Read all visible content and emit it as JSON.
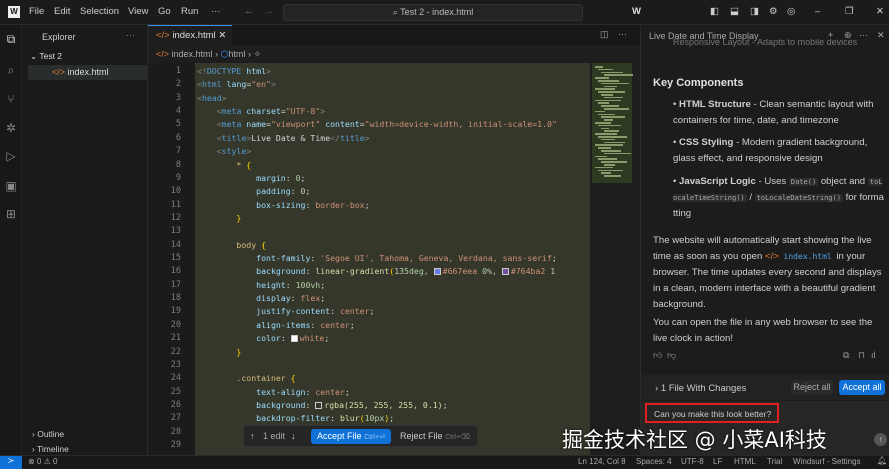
{
  "menu": [
    "File",
    "Edit",
    "Selection",
    "View",
    "Go",
    "Run",
    "···"
  ],
  "search": "⌕ Test 2 - index.html",
  "explorer": {
    "title": "Explorer",
    "folder": "Test 2",
    "file": "index.html",
    "outline": "Outline",
    "timeline": "Timeline"
  },
  "editor": {
    "tab": "index.html",
    "crumb_file": "index.html",
    "crumb_html": "html",
    "lines": [
      [
        [
          "<!",
          "br"
        ],
        [
          "DOCTYPE",
          "tag"
        ],
        [
          " html",
          "attr"
        ],
        [
          ">",
          "br"
        ]
      ],
      [
        [
          "<",
          "br"
        ],
        [
          "html",
          "tag"
        ],
        [
          " lang",
          "attr"
        ],
        [
          "=",
          "txt"
        ],
        [
          "\"en\"",
          "str"
        ],
        [
          ">",
          "br"
        ]
      ],
      [
        [
          "<",
          "br"
        ],
        [
          "head",
          "tag"
        ],
        [
          ">",
          "br"
        ]
      ],
      [
        [
          "    <",
          "br"
        ],
        [
          "meta",
          "tag"
        ],
        [
          " charset",
          "attr"
        ],
        [
          "=",
          "txt"
        ],
        [
          "\"UTF-8\"",
          "str"
        ],
        [
          ">",
          "br"
        ]
      ],
      [
        [
          "    <",
          "br"
        ],
        [
          "meta",
          "tag"
        ],
        [
          " name",
          "attr"
        ],
        [
          "=",
          "txt"
        ],
        [
          "\"viewport\"",
          "str"
        ],
        [
          " content",
          "attr"
        ],
        [
          "=",
          "txt"
        ],
        [
          "\"width=device-width, initial-scale=1.0\"",
          "str"
        ]
      ],
      [
        [
          "    <",
          "br"
        ],
        [
          "title",
          "tag"
        ],
        [
          ">",
          "br"
        ],
        [
          "Live Date & Time",
          "txt"
        ],
        [
          "</",
          "br"
        ],
        [
          "title",
          "tag"
        ],
        [
          ">",
          "br"
        ]
      ],
      [
        [
          "    <",
          "br"
        ],
        [
          "style",
          "tag"
        ],
        [
          ">",
          "br"
        ]
      ],
      [
        [
          "        * ",
          "sel"
        ],
        [
          "{",
          "bra"
        ]
      ],
      [
        [
          "            margin",
          "prop"
        ],
        [
          ": ",
          "txt"
        ],
        [
          "0",
          "num"
        ],
        [
          ";",
          "txt"
        ]
      ],
      [
        [
          "            padding",
          "prop"
        ],
        [
          ": ",
          "txt"
        ],
        [
          "0",
          "num"
        ],
        [
          ";",
          "txt"
        ]
      ],
      [
        [
          "            box-sizing",
          "prop"
        ],
        [
          ": ",
          "txt"
        ],
        [
          "border-box",
          "val"
        ],
        [
          ";",
          "txt"
        ]
      ],
      [
        [
          "        }",
          "bra"
        ]
      ],
      [],
      [
        [
          "        body ",
          "sel"
        ],
        [
          "{",
          "bra"
        ]
      ],
      [
        [
          "            font-family",
          "prop"
        ],
        [
          ": ",
          "txt"
        ],
        [
          "'Segoe UI', Tahoma, Geneva, Verdana, sans-serif",
          "val"
        ],
        [
          ";",
          "txt"
        ]
      ],
      [
        [
          "            background",
          "prop"
        ],
        [
          ": ",
          "txt"
        ],
        [
          "linear-gradient",
          "fn"
        ],
        [
          "(",
          "bra"
        ],
        [
          "135deg, ",
          "num"
        ],
        [
          "#667eea",
          "sw1"
        ],
        [
          " 0%, ",
          "num"
        ],
        [
          "#764ba2",
          "sw2"
        ],
        [
          " 1",
          "num"
        ]
      ],
      [
        [
          "            height",
          "prop"
        ],
        [
          ": ",
          "txt"
        ],
        [
          "100vh",
          "num"
        ],
        [
          ";",
          "txt"
        ]
      ],
      [
        [
          "            display",
          "prop"
        ],
        [
          ": ",
          "txt"
        ],
        [
          "flex",
          "val"
        ],
        [
          ";",
          "txt"
        ]
      ],
      [
        [
          "            justify-content",
          "prop"
        ],
        [
          ": ",
          "txt"
        ],
        [
          "center",
          "val"
        ],
        [
          ";",
          "txt"
        ]
      ],
      [
        [
          "            align-items",
          "prop"
        ],
        [
          ": ",
          "txt"
        ],
        [
          "center",
          "val"
        ],
        [
          ";",
          "txt"
        ]
      ],
      [
        [
          "            color",
          "prop"
        ],
        [
          ": ",
          "txt"
        ],
        [
          "white",
          "sw3"
        ],
        [
          ";",
          "txt"
        ]
      ],
      [
        [
          "        }",
          "bra"
        ]
      ],
      [],
      [
        [
          "        .container ",
          "sel"
        ],
        [
          "{",
          "bra"
        ]
      ],
      [
        [
          "            text-align",
          "prop"
        ],
        [
          ": ",
          "txt"
        ],
        [
          "center",
          "val"
        ],
        [
          ";",
          "txt"
        ]
      ],
      [
        [
          "            background",
          "prop"
        ],
        [
          ": ",
          "txt"
        ],
        [
          "rgba(255, 255, 255, 0.1)",
          "sw4"
        ],
        [
          ";",
          "txt"
        ]
      ],
      [
        [
          "            backdrop-filter",
          "prop"
        ],
        [
          ": ",
          "txt"
        ],
        [
          "blur",
          "fn"
        ],
        [
          "(",
          "bra"
        ],
        [
          "10px",
          "num"
        ],
        [
          ")",
          "bra"
        ],
        [
          ";",
          "txt"
        ]
      ],
      [],
      []
    ],
    "acceptbar": {
      "edit": "1 edit",
      "accept": "Accept File",
      "accept_key": "Ctrl+⏎",
      "reject": "Reject File",
      "reject_key": "Ctrl+⌫"
    }
  },
  "panel": {
    "title": "Live Date and Time Display",
    "cutoff": "Responsive Layout - Adapts to mobile devices",
    "heading": "Key Components",
    "bullets": [
      {
        "b": "HTML Structure",
        "t": " - Clean semantic layout with containers for time, date, and timezone"
      },
      {
        "b": "CSS Styling",
        "t": " - Modern gradient background, glass effect, and responsive design"
      },
      {
        "b": "JavaScript Logic",
        "t": " - Uses ",
        "c1": "Date()",
        "t2": " object and ",
        "c2": "toLocaleTimeString()",
        "t3": " / ",
        "c3": "toLocaleDateString()",
        "t4": " for formatting"
      }
    ],
    "para1a": "The website will automatically start showing the live time as soon as you open ",
    "para1file": "index.html",
    "para1b": " in your browser. The time updates every second and displays in a clean, modern interface with a beautiful gradient background.",
    "para2": "You can open the file in any web browser to see the live clock in action!",
    "changes": "1 File With Changes",
    "reject_all": "Reject all",
    "accept_all": "Accept all",
    "input": "Can you make this look better?"
  },
  "status": {
    "problems": "⊗ 0 ⚠ 0",
    "pos": "Ln 124, Col 8",
    "spaces": "Spaces: 4",
    "enc": "UTF-8",
    "eol": "LF",
    "lang": "HTML",
    "trial": "Trial",
    "settings": "Windsurf - Settings"
  },
  "watermark": "掘金技术社区 @ 小菜AI科技",
  "colors": {
    "accent": "#0e72d8",
    "sw1": "#667eea",
    "sw2": "#764ba2"
  }
}
